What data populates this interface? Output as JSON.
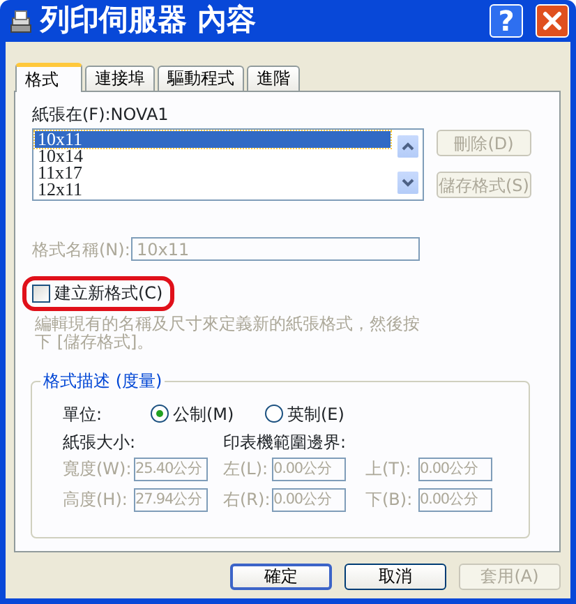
{
  "window": {
    "title": "列印伺服器 內容",
    "help_button": "?"
  },
  "tabs": [
    {
      "label": "格式",
      "selected": true
    },
    {
      "label": "連接埠",
      "selected": false
    },
    {
      "label": "驅動程式",
      "selected": false
    },
    {
      "label": "進階",
      "selected": false
    }
  ],
  "paper_source_label": "紙張在(F):NOVA1",
  "forms_list": [
    {
      "label": "10x11",
      "selected": true
    },
    {
      "label": "10x14",
      "selected": false
    },
    {
      "label": "11x17",
      "selected": false
    },
    {
      "label": "12x11",
      "selected": false
    }
  ],
  "side_buttons": [
    {
      "label": "刪除(D)",
      "disabled": true
    },
    {
      "label": "儲存格式(S)",
      "disabled": true
    }
  ],
  "form_name": {
    "label": "格式名稱(N):",
    "value": "10x11",
    "disabled": true
  },
  "create_new": {
    "label": "建立新格式(C)",
    "checked": false,
    "circled": true
  },
  "hint": "編輯現有的名稱及尺寸來定義新的紙張格式，然後按下 [儲存格式]。",
  "description_group": {
    "title": "格式描述 (度量)",
    "units_label": "單位:",
    "units": [
      {
        "label": "公制(M)",
        "selected": true
      },
      {
        "label": "英制(E)",
        "selected": false
      }
    ],
    "paper_size_label": "紙張大小:",
    "margins_label": "印表機範圍邊界:",
    "fields": [
      {
        "label": "寬度(W):",
        "value": "25.40公分"
      },
      {
        "label": "左(L):",
        "value": "0.00公分"
      },
      {
        "label": "上(T):",
        "value": "0.00公分"
      },
      {
        "label": "高度(H):",
        "value": "27.94公分"
      },
      {
        "label": "右(R):",
        "value": "0.00公分"
      },
      {
        "label": "下(B):",
        "value": "0.00公分"
      }
    ]
  },
  "buttons": [
    {
      "label": "確定",
      "kind": "default",
      "disabled": false
    },
    {
      "label": "取消",
      "kind": "normal",
      "disabled": false
    },
    {
      "label": "套用(A)",
      "kind": "normal",
      "disabled": true
    }
  ]
}
